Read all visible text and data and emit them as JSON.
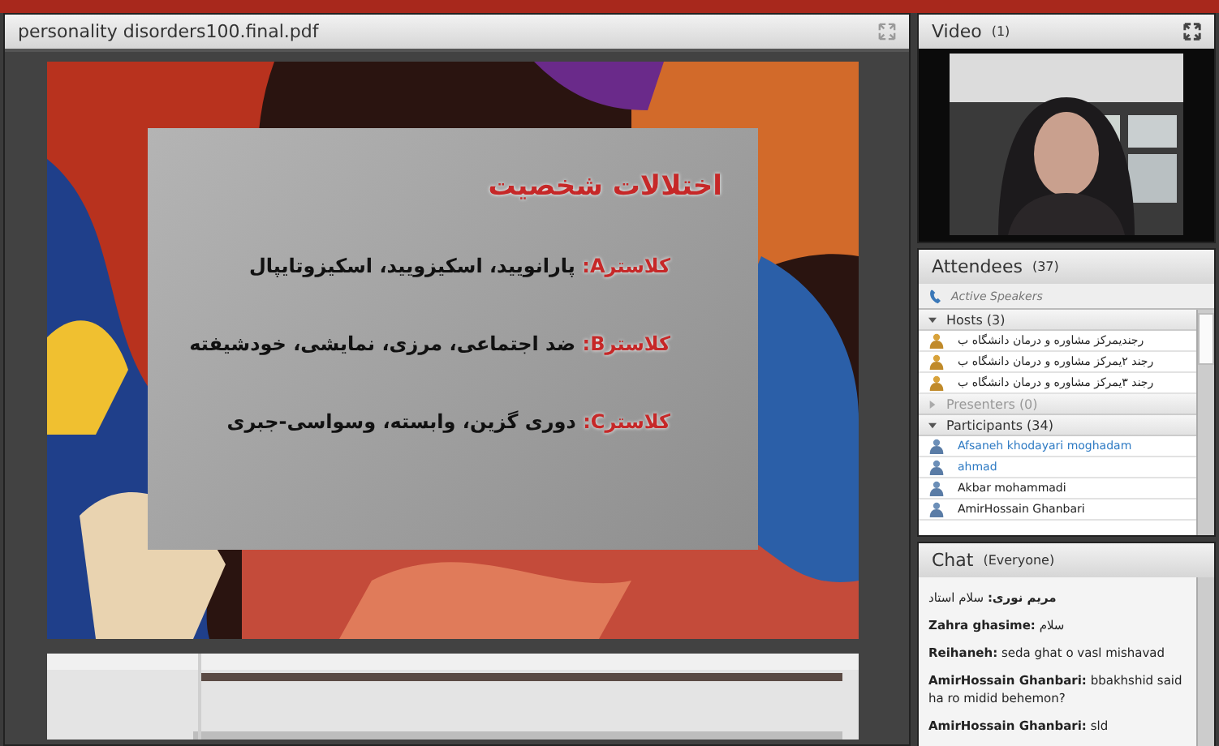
{
  "document_pod": {
    "title": "personality disorders100.final.pdf",
    "slide": {
      "kind": "picture",
      "title": "اختلالات شخصیت",
      "items": [
        {
          "label": "کلاسترA:",
          "text": "پارانویید، اسکیزویید، اسکیزوتایپال"
        },
        {
          "label": "کلاسترB:",
          "text": "ضد اجتماعی، مرزی، نمایشی، خودشیفته"
        },
        {
          "label": "کلاسترC:",
          "text": "دوری گزین، وابسته، وسواسی-جبری"
        }
      ]
    }
  },
  "video_pod": {
    "title": "Video",
    "count": "(1)"
  },
  "attendees_pod": {
    "title": "Attendees",
    "count": "(37)",
    "active_speakers": "Active Speakers",
    "groups": [
      {
        "label": "Hosts (3)",
        "expanded": true,
        "people": [
          {
            "name": "رجندیمرکز مشاوره و درمان دانشگاه ب",
            "active": false
          },
          {
            "name": "رجند ۲یمرکز مشاوره و درمان دانشگاه ب",
            "active": false
          },
          {
            "name": "رجند ۳یمرکز مشاوره و درمان دانشگاه ب",
            "active": false
          }
        ]
      },
      {
        "label": "Presenters (0)",
        "expanded": false
      },
      {
        "label": "Participants (34)",
        "expanded": true,
        "people": [
          {
            "name": "Afsaneh khodayari moghadam",
            "active": true
          },
          {
            "name": "ahmad",
            "active": true
          },
          {
            "name": "Akbar mohammadi",
            "active": false
          },
          {
            "name": "AmirHossain Ghanbari",
            "active": false
          }
        ]
      }
    ]
  },
  "chat_pod": {
    "title": "Chat",
    "scope": "(Everyone)",
    "messages": [
      {
        "sender": "مریم نوری:",
        "text": "سلام استاد"
      },
      {
        "sender": "Zahra ghasime:",
        "text": "سلام"
      },
      {
        "sender": "Reihaneh:",
        "text": "seda ghat o vasl mishavad"
      },
      {
        "sender": "AmirHossain Ghanbari:",
        "text": "bbakhshid said  ha ro midid behemon?"
      },
      {
        "sender": "AmirHossain Ghanbari:",
        "text": "sld"
      }
    ]
  }
}
